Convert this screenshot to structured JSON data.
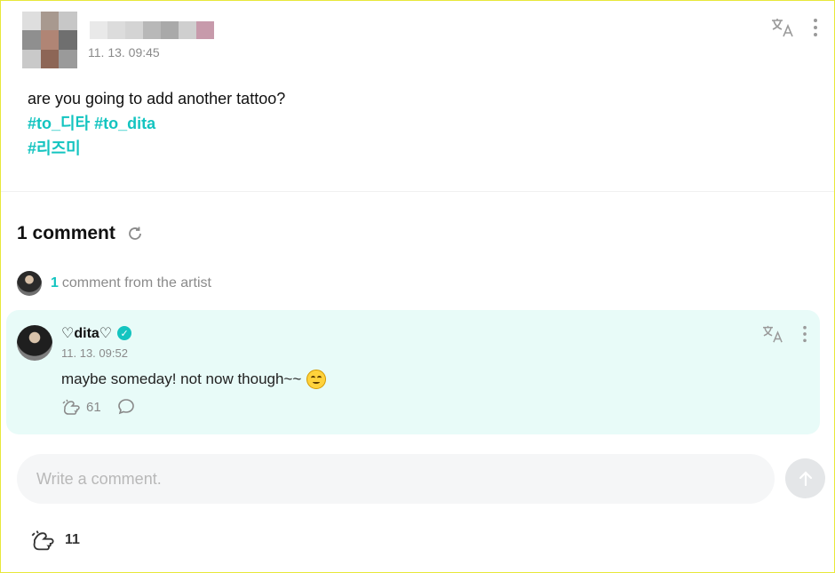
{
  "post": {
    "author_name": "",
    "timestamp": "11. 13. 09:45",
    "body": "are you going to add another tattoo?",
    "hashtags": [
      "#to_디타",
      "#to_dita",
      "#리즈미"
    ],
    "translate_icon": "translate-icon",
    "more_icon": "more-vertical-icon"
  },
  "comments": {
    "count_number": "1",
    "title": "1 comment",
    "refresh_icon": "refresh-icon",
    "artist_count": "1",
    "artist_label": "comment from the artist"
  },
  "artist_comment": {
    "author": "♡dita♡",
    "timestamp": "11. 13. 09:52",
    "text": "maybe someday! not now though~~",
    "emoji": "smiling-face-emoji",
    "like_count": "61",
    "verified": true
  },
  "composer": {
    "placeholder": "Write a comment.",
    "value": ""
  },
  "post_likes": {
    "count": "11"
  },
  "colors": {
    "accent": "#14c4c0",
    "card_bg": "#e8fbf8",
    "muted": "#8a8a8a"
  }
}
